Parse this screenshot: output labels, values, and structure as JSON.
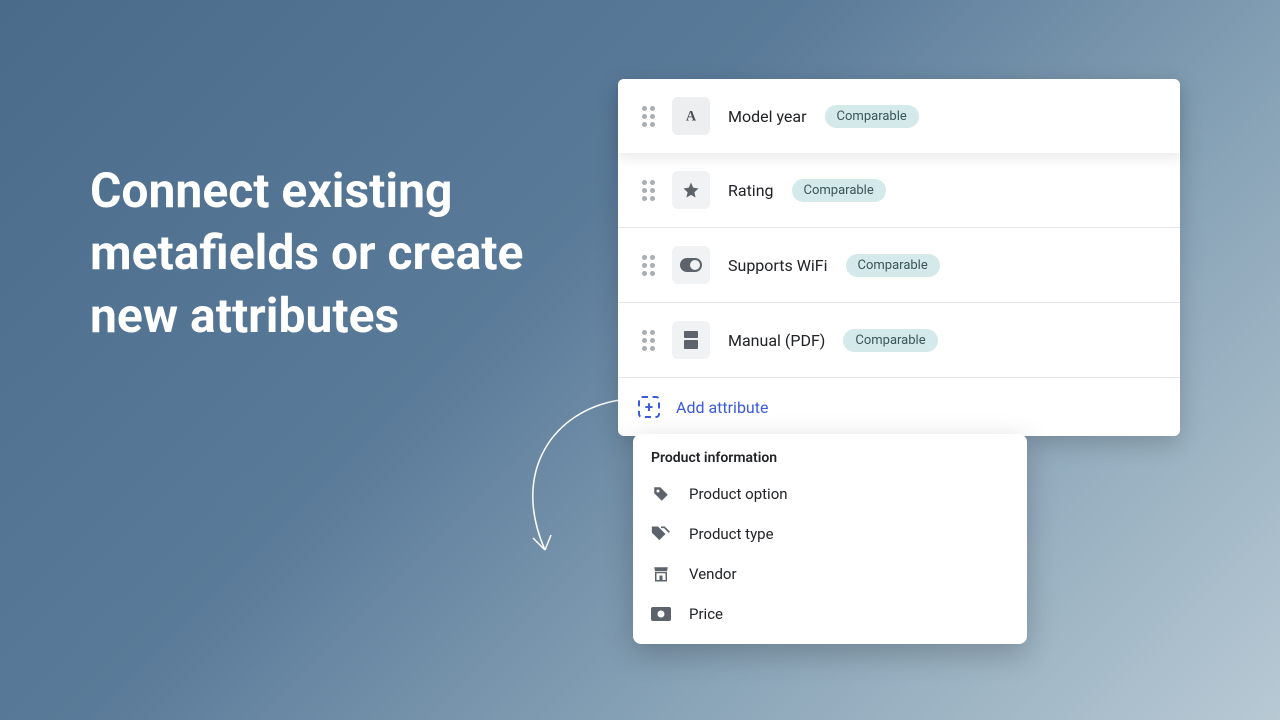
{
  "headline": "Connect existing metafields or create new attributes",
  "attributes": [
    {
      "label": "Model year",
      "badge": "Comparable",
      "icon": "text"
    },
    {
      "label": "Rating",
      "badge": "Comparable",
      "icon": "star"
    },
    {
      "label": "Supports WiFi",
      "badge": "Comparable",
      "icon": "toggle"
    },
    {
      "label": "Manual (PDF)",
      "badge": "Comparable",
      "icon": "file"
    }
  ],
  "add_attribute_label": "Add attribute",
  "popover": {
    "title": "Product information",
    "items": [
      {
        "label": "Product option",
        "icon": "tag"
      },
      {
        "label": "Product type",
        "icon": "tags"
      },
      {
        "label": "Vendor",
        "icon": "store"
      },
      {
        "label": "Price",
        "icon": "money"
      }
    ]
  }
}
